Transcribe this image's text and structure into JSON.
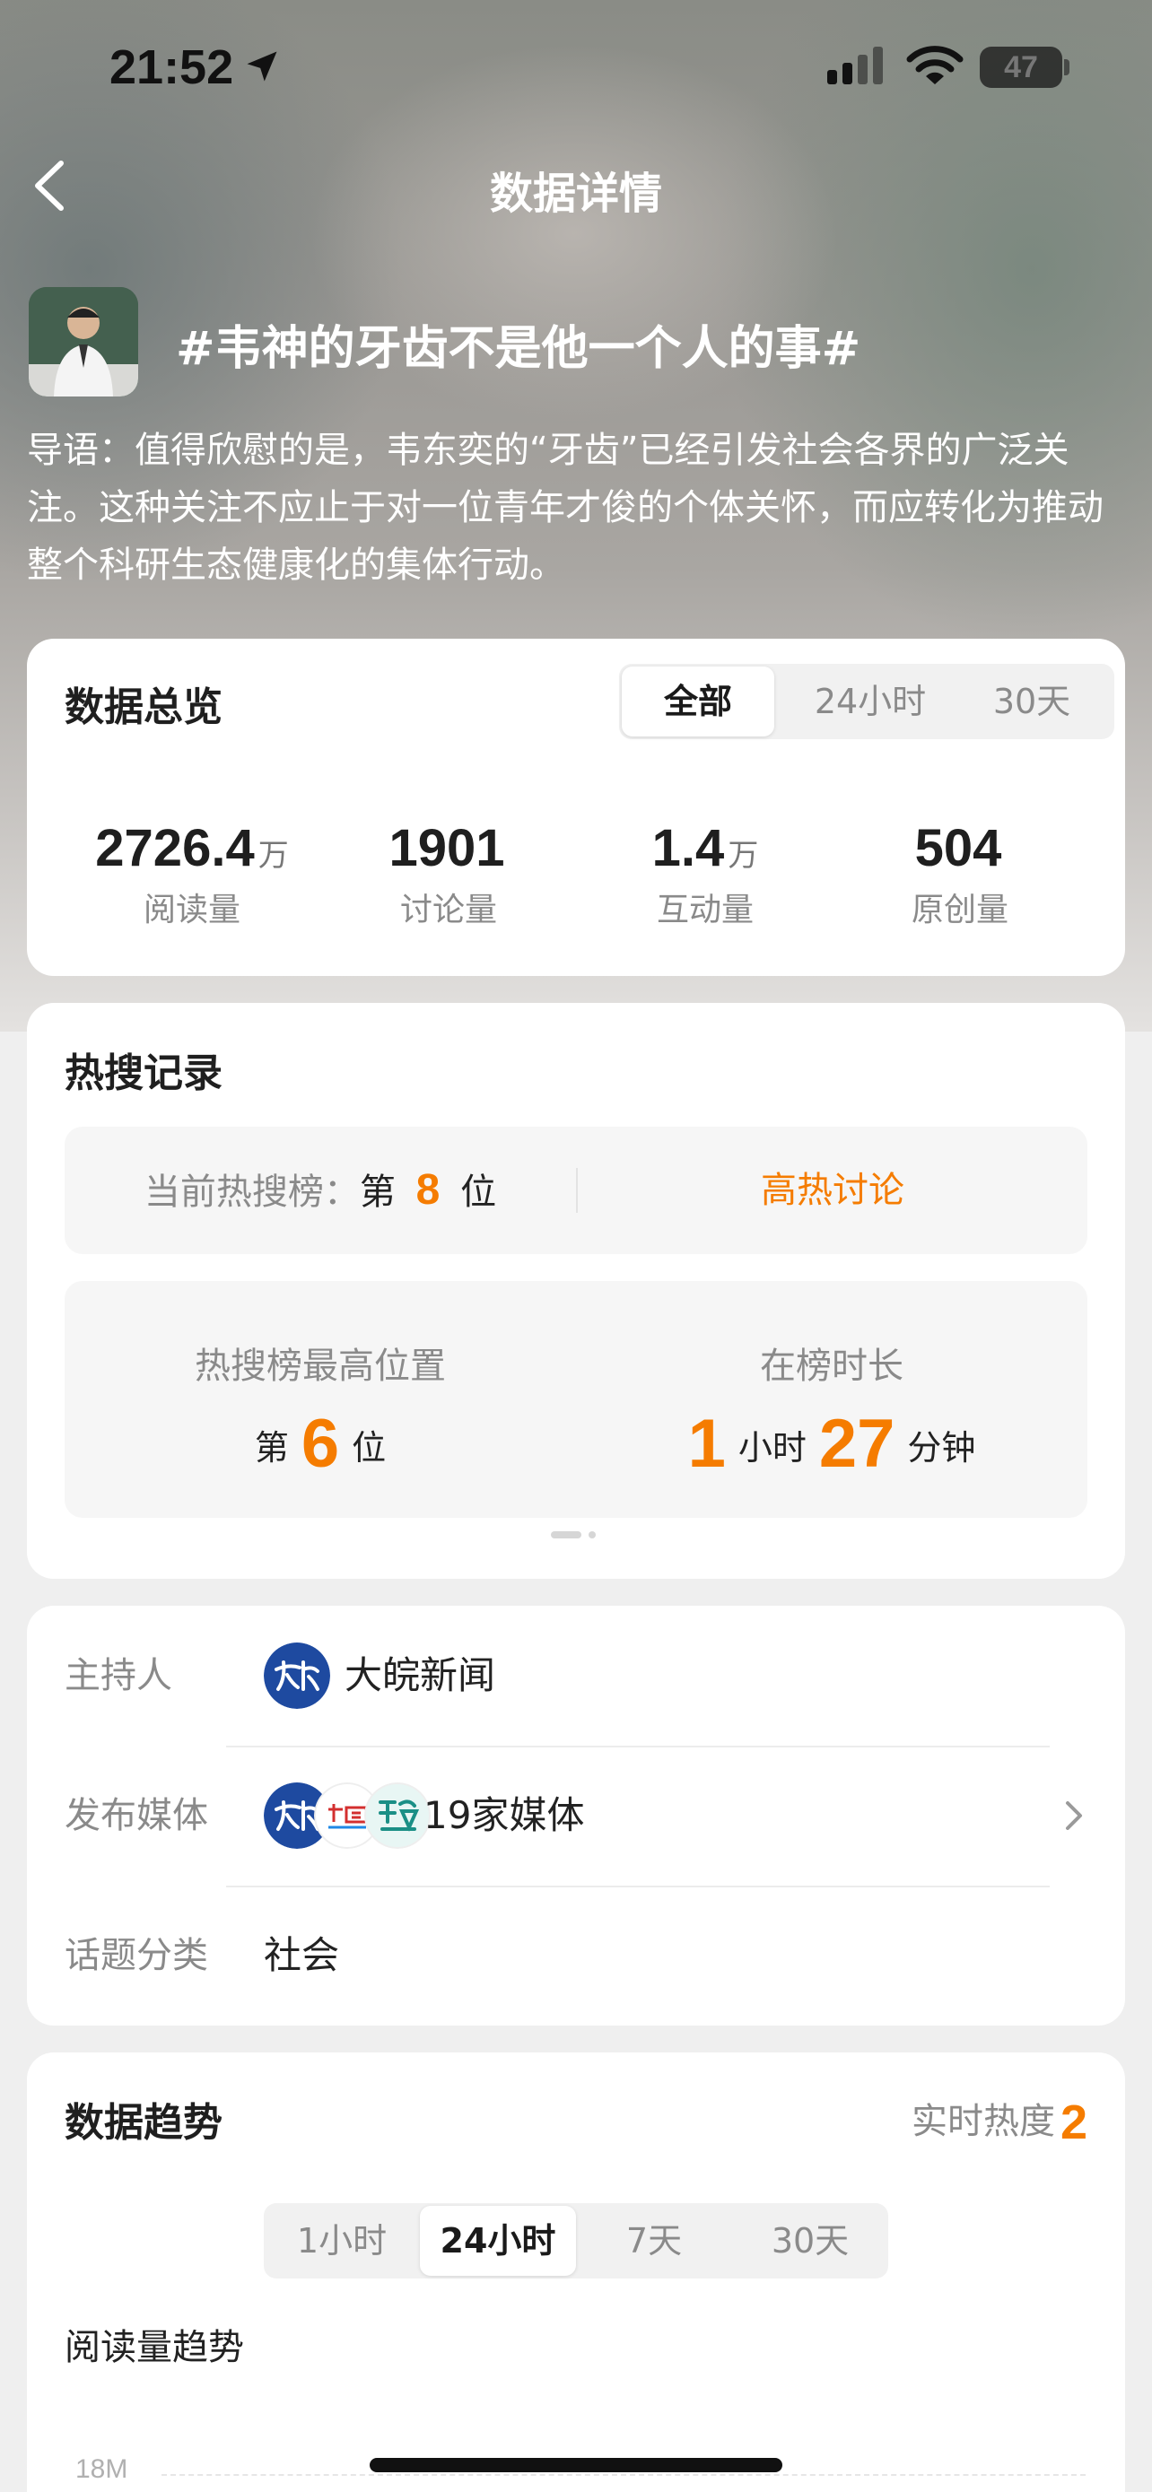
{
  "status_bar": {
    "time": "21:52",
    "battery": "47"
  },
  "nav": {
    "title": "数据详情"
  },
  "topic": {
    "title": "#韦神的牙齿不是他一个人的事#",
    "intro": "导语：值得欣慰的是，韦东奕的“牙齿”已经引发社会各界的广泛关注。这种关注不应止于对一位青年才俊的个体关怀，而应转化为推动整个科研生态健康化的集体行动。"
  },
  "overview": {
    "title": "数据总览",
    "tabs": [
      "全部",
      "24小时",
      "30天"
    ],
    "active_tab": "全部",
    "stats": [
      {
        "value": "2726.4",
        "unit": "万",
        "label": "阅读量"
      },
      {
        "value": "1901",
        "unit": "",
        "label": "讨论量"
      },
      {
        "value": "1.4",
        "unit": "万",
        "label": "互动量"
      },
      {
        "value": "504",
        "unit": "",
        "label": "原创量"
      }
    ]
  },
  "hot_search": {
    "title": "热搜记录",
    "current_label": "当前热搜榜：",
    "current_prefix": "第",
    "current_rank": "8",
    "current_suffix": "位",
    "status": "高热讨论",
    "best_label": "热搜榜最高位置",
    "best_prefix": "第",
    "best_rank": "6",
    "best_suffix": "位",
    "duration_label": "在榜时长",
    "duration_hours": "1",
    "hours_unit": "小时",
    "duration_minutes": "27",
    "minutes_unit": "分钟"
  },
  "info": {
    "host_label": "主持人",
    "host_name": "大皖新闻",
    "media_label": "发布媒体",
    "media_count": "19家媒体",
    "category_label": "话题分类",
    "category": "社会",
    "colors": {
      "logo_blue": "#1e4aa0"
    }
  },
  "trend": {
    "title": "数据趋势",
    "heat_label": "实时热度",
    "heat_value": "2",
    "tabs": [
      "1小时",
      "24小时",
      "7天",
      "30天"
    ],
    "active_tab": "24小时",
    "subtitle": "阅读量趋势",
    "y_axis_top": "18M"
  },
  "colors": {
    "accent": "#f57c00"
  }
}
